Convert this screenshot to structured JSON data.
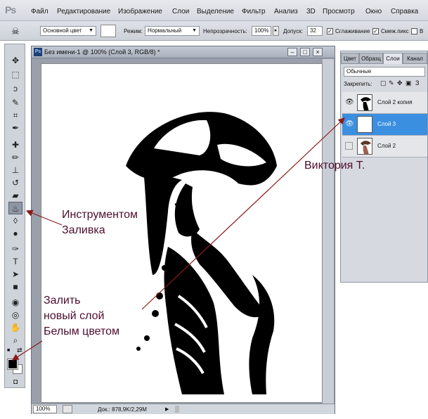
{
  "app": {
    "logo": "Ps"
  },
  "menu": [
    "Файл",
    "Редактирование",
    "Изображение",
    "Слои",
    "Выделение",
    "Фильтр",
    "Анализ",
    "3D",
    "Просмотр",
    "Окно",
    "Справка"
  ],
  "options": {
    "tool_icon": "paint-bucket-icon",
    "fill_source": "Основной цвет",
    "mode_label": "Режим:",
    "mode_value": "Нормальный",
    "opacity_label": "Непрозрачность:",
    "opacity_value": "100%",
    "tolerance_label": "Допуск:",
    "tolerance_value": "32",
    "antialias_label": "Сглаживание",
    "contiguous_label": "Смеж.пикс",
    "all_layers_label": "В"
  },
  "document": {
    "badge": "Ps",
    "title": "Без имени-1 @ 100% (Слой 3, RGB/8) *",
    "zoom": "100%",
    "doc_size": "Док.: 878,9K/2,29M"
  },
  "layers_panel": {
    "tabs": [
      "Цвет",
      "Образц",
      "Слои",
      "Канал"
    ],
    "active_tab": "Слои",
    "blend_mode": "Обычные",
    "lock_label": "Закрепить:",
    "layers": [
      {
        "name": "Слой 2 копия",
        "visible": true,
        "selected": false
      },
      {
        "name": "Слой 3",
        "visible": true,
        "selected": true
      },
      {
        "name": "Слой 2",
        "visible": false,
        "selected": false
      }
    ]
  },
  "annotations": {
    "author": "Виктория Т.",
    "tool_note_1": "Инструментом",
    "tool_note_2": "Заливка",
    "fill_note_1": "Залить",
    "fill_note_2": "новый слой",
    "fill_note_3": "Белым цветом"
  },
  "colors": {
    "foreground": "#000000",
    "background": "#ffffff",
    "selection": "#3a8fe0",
    "annotation": "#4d0d2c",
    "arrow": "#8b1a1a"
  }
}
